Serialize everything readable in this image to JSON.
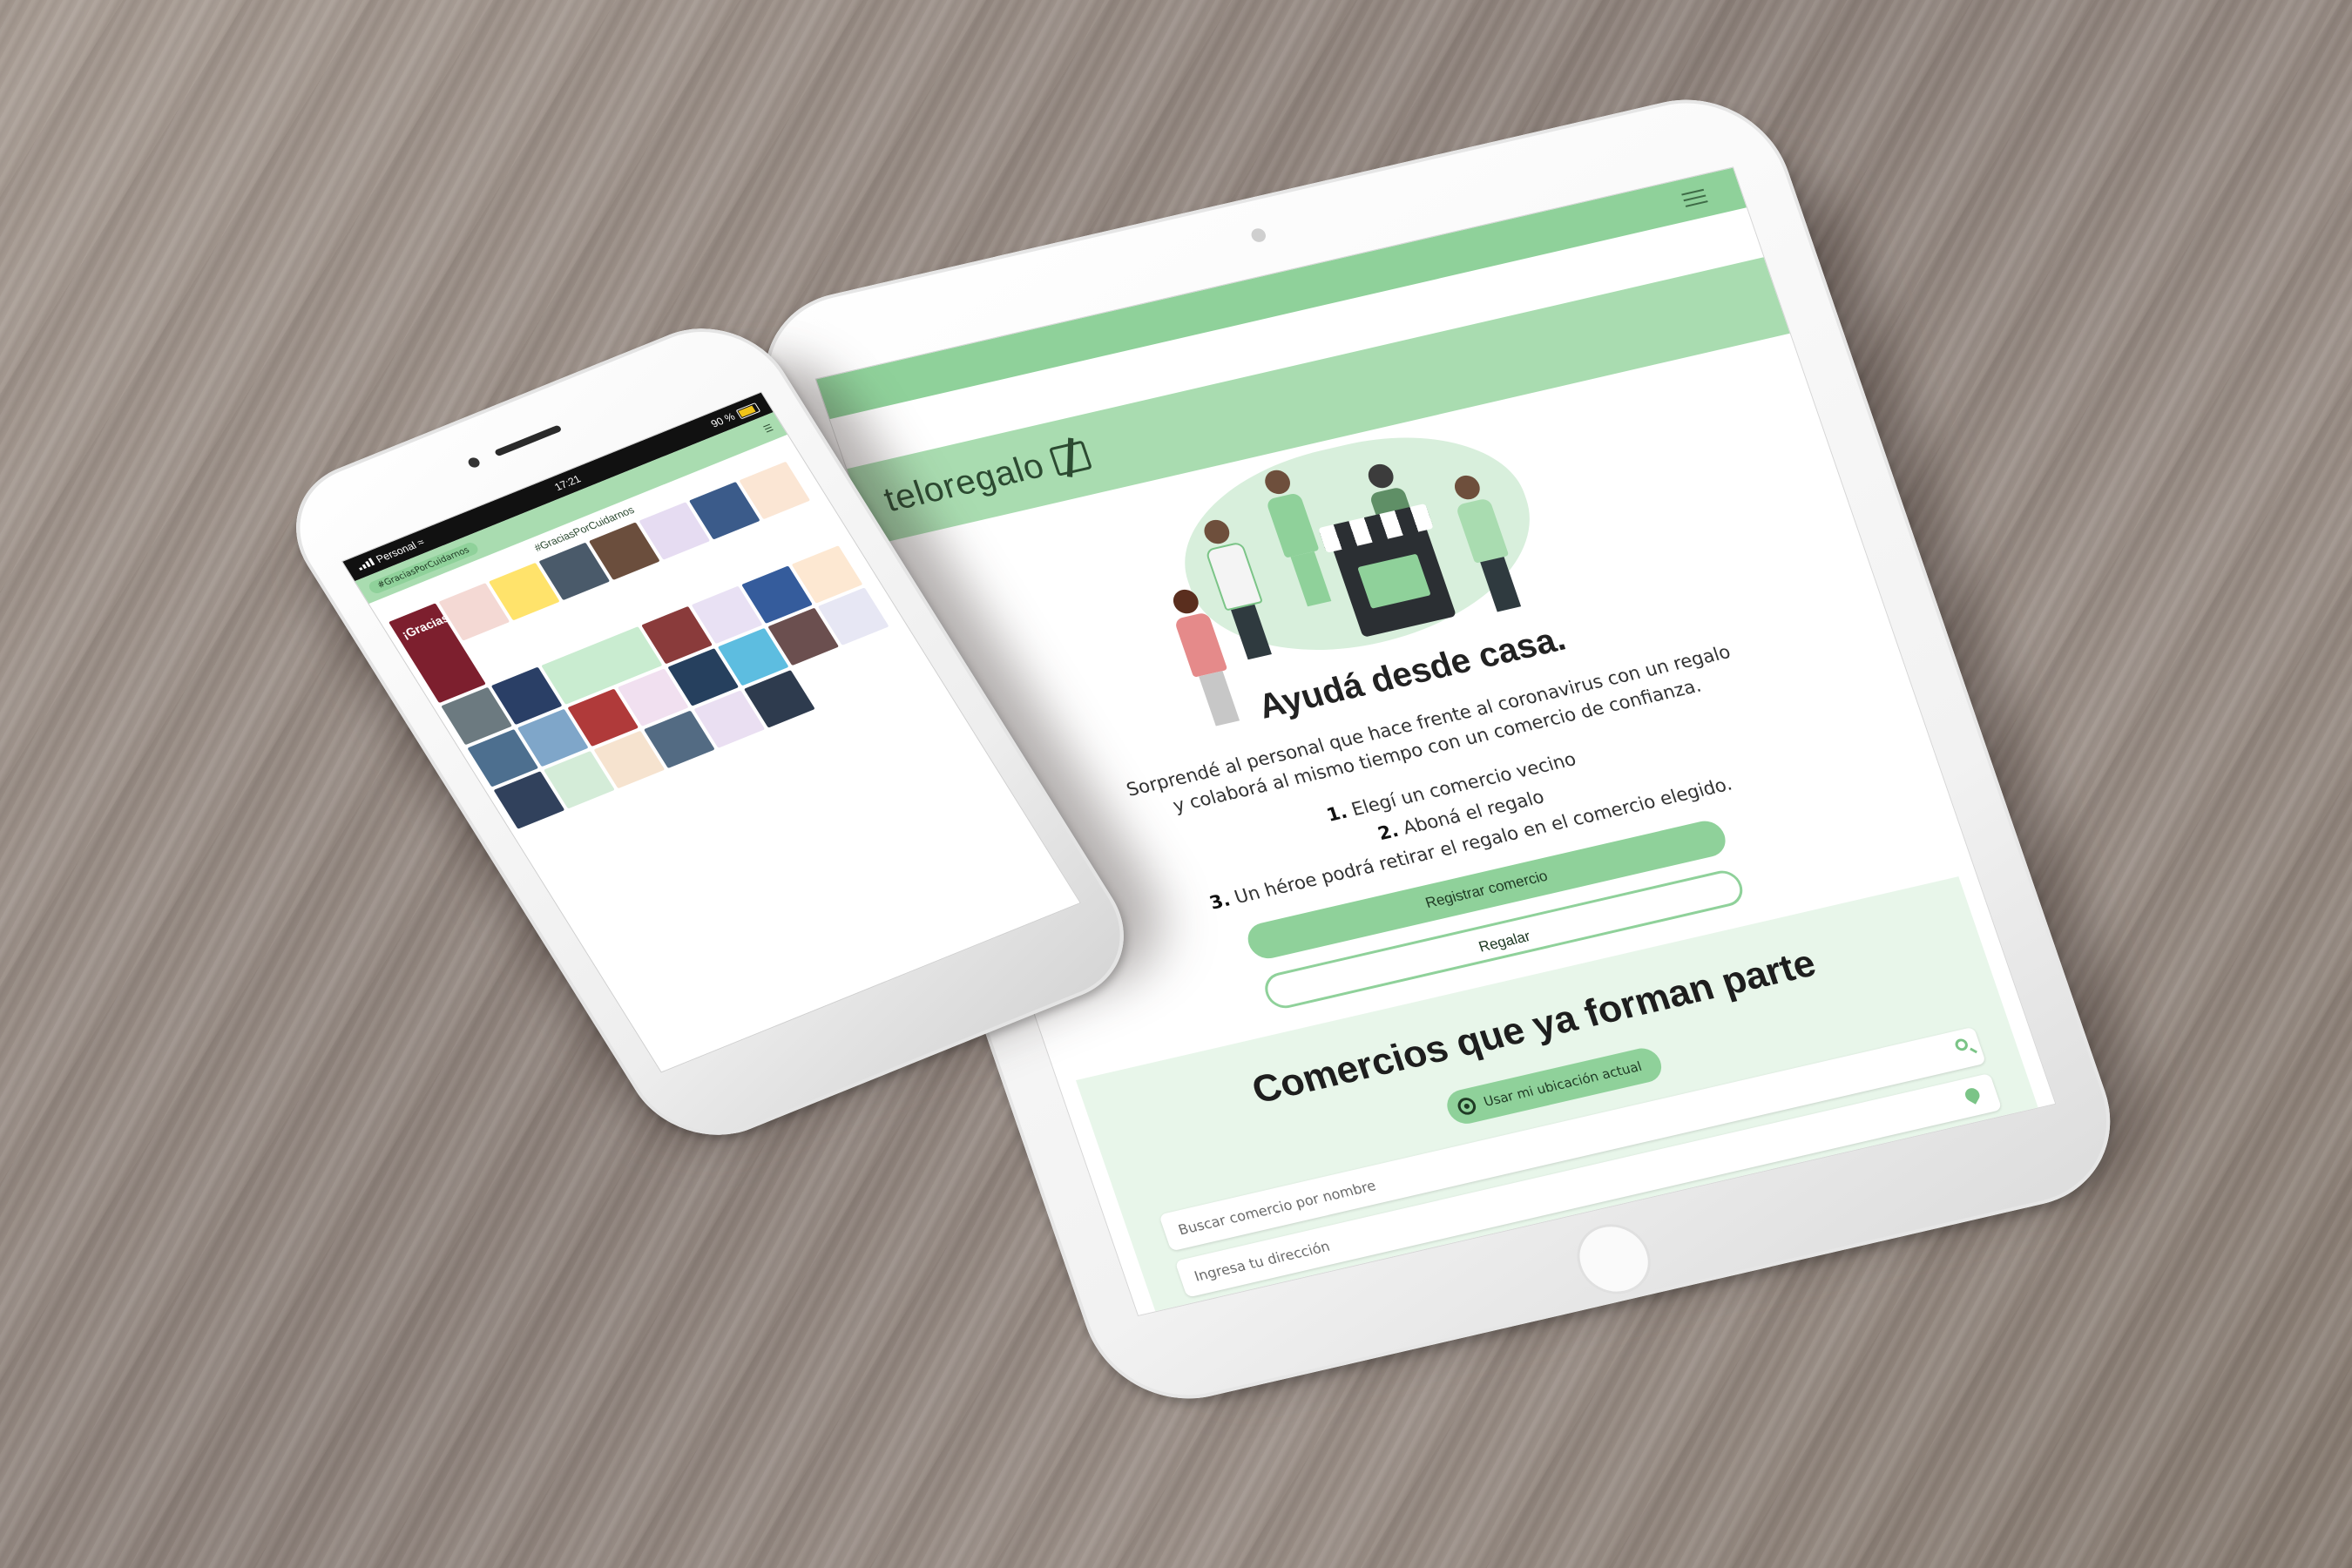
{
  "tablet": {
    "brand": "teloregalo",
    "hero_title": "Ayudá desde casa.",
    "lead": "Sorprendé al personal que hace frente al coronavirus con un regalo y colaborá al mismo tiempo con un comercio de confianza.",
    "steps": [
      {
        "num": "1.",
        "text": "Elegí un comercio vecino"
      },
      {
        "num": "2.",
        "text": "Aboná el regalo"
      },
      {
        "num": "3.",
        "text": "Un héroe podrá retirar el regalo en el comercio elegido."
      }
    ],
    "buttons": {
      "register": "Registrar comercio",
      "gift": "Regalar"
    },
    "section_title": "Comercios que ya forman parte",
    "location_button": "Usar mi ubicación actual",
    "search_placeholder": "Buscar comercio por nombre",
    "address_placeholder": "Ingresa tu dirección"
  },
  "phone": {
    "carrier": "Personal",
    "time": "17:21",
    "battery": "90 %",
    "hashtag": "#GraciasPorCuidarnos",
    "gracias_tile": "¡Gracias!"
  },
  "colors": {
    "accent": "#8fd19a",
    "accent_light": "#a9dcb0",
    "section_bg": "#e8f6ea",
    "dark_text": "#1f3a24"
  },
  "icons": [
    "menu-icon",
    "logo-icon",
    "search-icon",
    "map-pin-icon",
    "target-icon",
    "signal-icon",
    "wifi-icon",
    "battery-icon"
  ]
}
